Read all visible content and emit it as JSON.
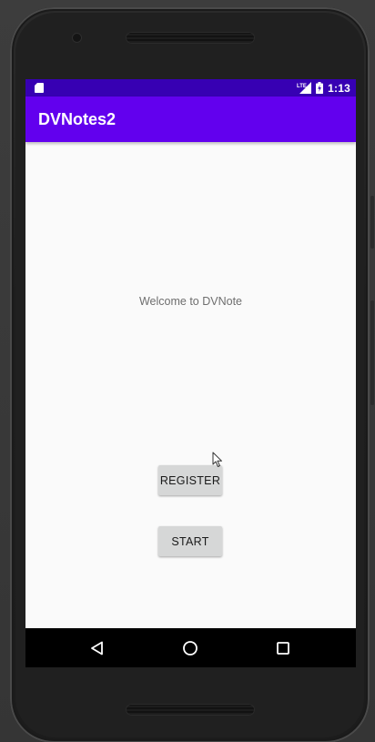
{
  "status_bar": {
    "time": "1:13",
    "network_label": "LTE",
    "icons": [
      "sd-card-icon",
      "lte-signal-icon",
      "battery-icon"
    ]
  },
  "app_bar": {
    "title": "DVNotes2"
  },
  "main": {
    "welcome_text": "Welcome to DVNote",
    "register_label": "REGISTER",
    "start_label": "START"
  },
  "nav_bar": {
    "icons": [
      "back-icon",
      "home-icon",
      "recents-icon"
    ]
  },
  "colors": {
    "status_bar": "#3700b3",
    "app_bar": "#6200ee",
    "background": "#fafafa",
    "button": "#d6d7d7",
    "nav_bar": "#000000"
  }
}
